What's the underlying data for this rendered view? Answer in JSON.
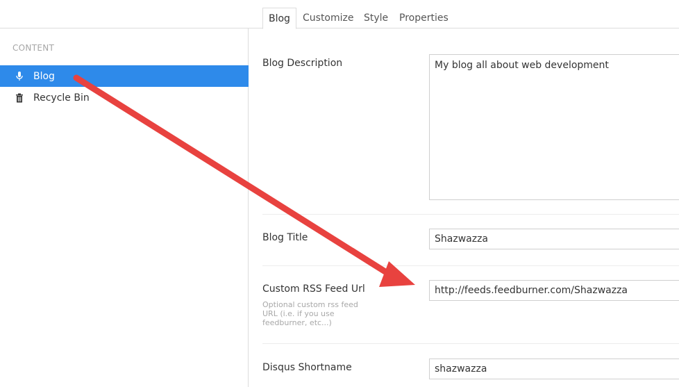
{
  "sidebar": {
    "section_title": "CONTENT",
    "items": [
      {
        "label": "Blog",
        "icon": "microphone-icon",
        "active": true
      },
      {
        "label": "Recycle Bin",
        "icon": "trash-icon",
        "active": false
      }
    ]
  },
  "tabs": [
    {
      "label": "Blog",
      "active": true
    },
    {
      "label": "Customize",
      "active": false
    },
    {
      "label": "Style",
      "active": false
    },
    {
      "label": "Properties",
      "active": false
    }
  ],
  "properties": {
    "blog_description": {
      "label": "Blog Description",
      "value": "My blog all about web development"
    },
    "blog_title": {
      "label": "Blog Title",
      "value": "Shazwazza"
    },
    "rss_feed": {
      "label": "Custom RSS Feed Url",
      "description": "Optional custom rss feed URL (i.e. if you use feedburner, etc...)",
      "value": "http://feeds.feedburner.com/Shazwazza"
    },
    "disqus": {
      "label": "Disqus Shortname",
      "value": "shazwazza"
    }
  },
  "colors": {
    "accent": "#2e8aea",
    "arrow": "#e8423f"
  }
}
